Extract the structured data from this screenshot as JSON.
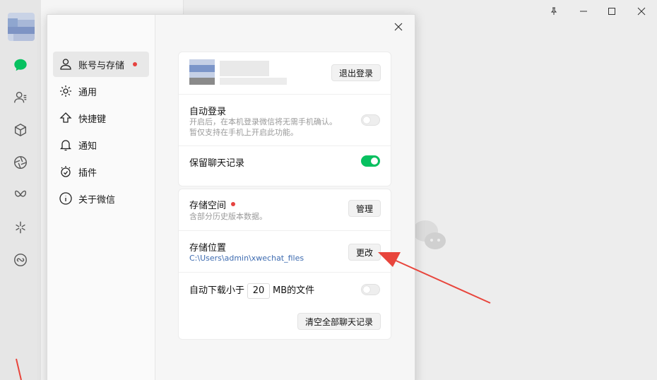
{
  "settings_menu": {
    "items": [
      {
        "label": "账号与存储",
        "icon": "person-icon",
        "has_dot": true
      },
      {
        "label": "通用",
        "icon": "gear-icon"
      },
      {
        "label": "快捷键",
        "icon": "shortcut-arrow-icon"
      },
      {
        "label": "通知",
        "icon": "bell-icon"
      },
      {
        "label": "插件",
        "icon": "plugin-bulb-icon"
      },
      {
        "label": "关于微信",
        "icon": "info-icon"
      }
    ]
  },
  "account_card": {
    "logout_label": "退出登录",
    "auto_login": {
      "title": "自动登录",
      "desc_line1": "开启后，在本机登录微信将无需手机确认。",
      "desc_line2": "暂仅支持在手机上开启此功能。",
      "enabled": false
    },
    "keep_history": {
      "title": "保留聊天记录",
      "enabled": true
    }
  },
  "storage_card": {
    "space": {
      "title": "存储空间",
      "desc": "含部分历史版本数据。",
      "button": "管理",
      "has_dot": true
    },
    "location": {
      "title": "存储位置",
      "path": "C:\\Users\\admin\\xwechat_files",
      "button": "更改"
    },
    "auto_download": {
      "prefix": "自动下载小于",
      "value": "20",
      "suffix": "MB的文件",
      "enabled": false
    },
    "clear_button": "清空全部聊天记录"
  },
  "colors": {
    "accent_green": "#07c160",
    "annotation_red": "#e8453c",
    "link_blue": "#3d6bb0"
  }
}
